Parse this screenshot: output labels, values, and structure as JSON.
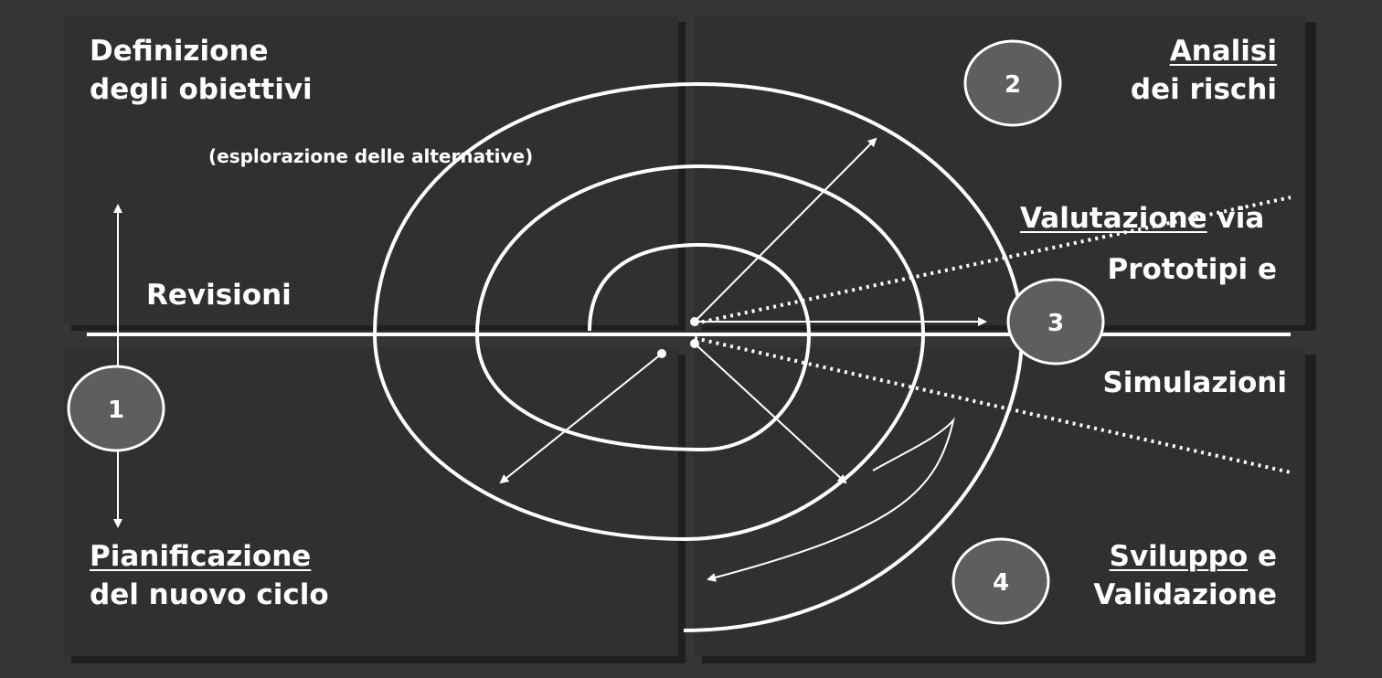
{
  "quadrants": {
    "top_left": {
      "title_line1": "Definizione",
      "title_line2": "degli obiettivi",
      "subtitle": "(esplorazione delle alternative)"
    },
    "top_right": {
      "title_line1": "Analisi",
      "title_line2": "dei rischi"
    },
    "bottom_left": {
      "title_line1": "Pianificazione",
      "title_line2": "del nuovo ciclo"
    },
    "bottom_right": {
      "title_word1": "Sviluppo",
      "title_word1_suffix": " e",
      "title_line2": "Validazione"
    }
  },
  "axis_label": "Revisioni",
  "evaluation": {
    "word": "Valutazione",
    "suffix": " via",
    "line2": "Prototipi e",
    "line3": "Simulazioni"
  },
  "badges": [
    "1",
    "2",
    "3",
    "4"
  ],
  "colors": {
    "background": "#353535",
    "panel": "#303030",
    "line": "#ffffff",
    "badge": "#5e5e5e"
  }
}
